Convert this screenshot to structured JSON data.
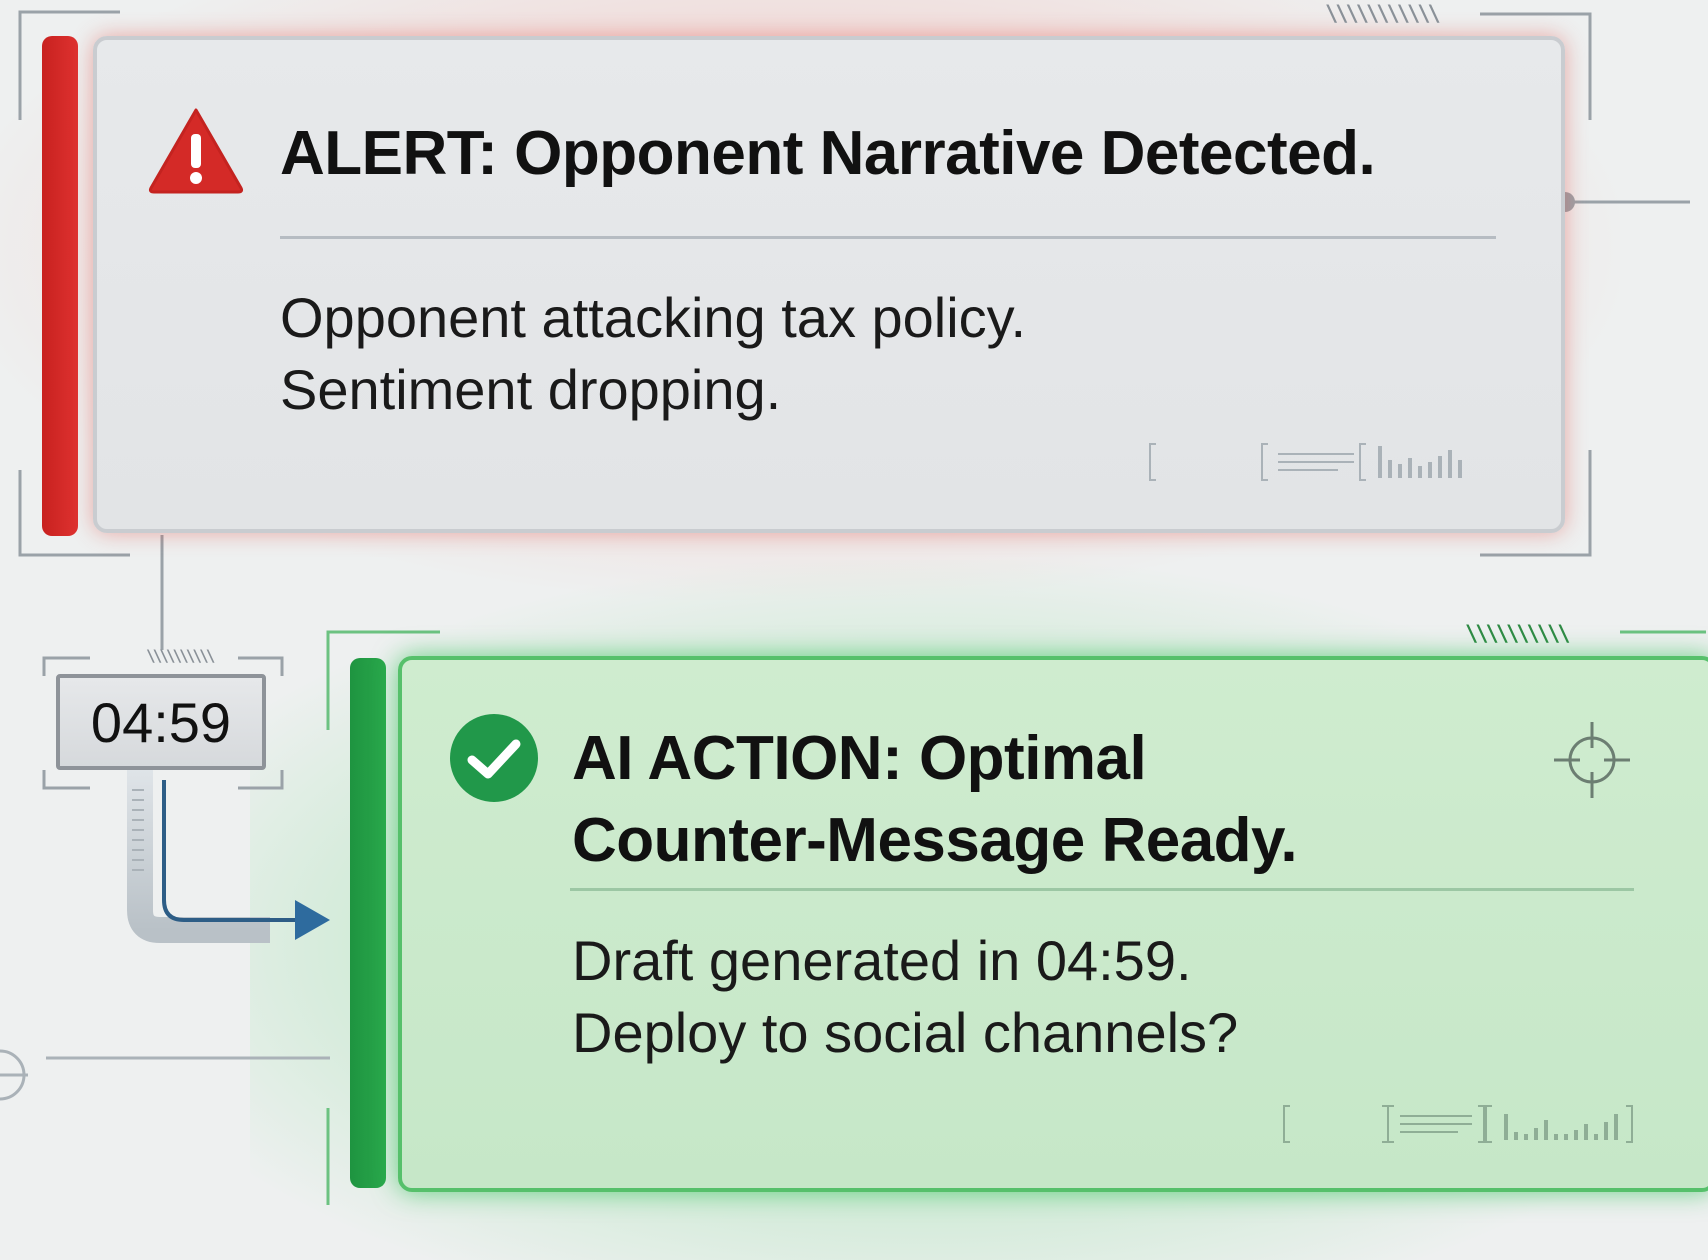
{
  "alert": {
    "title": "ALERT: Opponent Narrative Detected.",
    "body_line1": "Opponent attacking tax policy.",
    "body_line2": "Sentiment dropping.",
    "icon": "warning-triangle-icon",
    "accent_color": "#d42a27"
  },
  "timer": {
    "value": "04:59"
  },
  "action": {
    "title_line1": "AI ACTION: Optimal",
    "title_line2": "Counter-Message Ready.",
    "body_line1": "Draft generated in 04:59.",
    "body_line2": "Deploy to social channels?",
    "icon": "check-circle-icon",
    "accent_color": "#21984a"
  }
}
